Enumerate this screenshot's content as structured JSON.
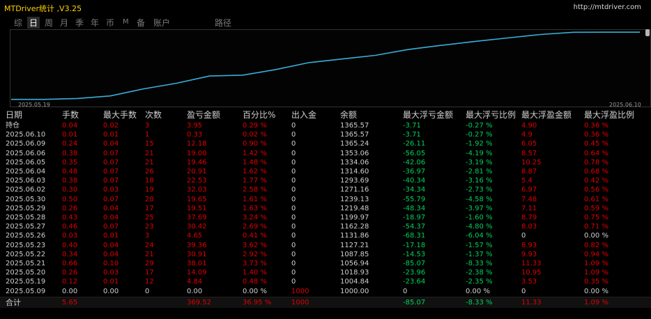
{
  "app": {
    "title": "MTDriver统计 ,V3.25",
    "url": "http://mtdriver.com"
  },
  "colors": {
    "accent_title": "#ffd200",
    "equity_line": "#3aaed8",
    "loss_red": "#e00000",
    "gain_green": "#00d25a"
  },
  "tabs": [
    {
      "label": "综",
      "active": false
    },
    {
      "label": "日",
      "active": true
    },
    {
      "label": "周",
      "active": false
    },
    {
      "label": "月",
      "active": false
    },
    {
      "label": "季",
      "active": false
    },
    {
      "label": "年",
      "active": false
    },
    {
      "label": "币",
      "active": false
    },
    {
      "label": "M",
      "active": false
    },
    {
      "label": "备",
      "active": false
    },
    {
      "label": "账户",
      "active": false
    },
    {
      "label": "路径",
      "active": false
    }
  ],
  "chart_data": {
    "type": "line",
    "x_start": "2025.05.19",
    "x_end": "2025.06.10",
    "series": [
      {
        "values": [
          1000,
          1000,
          1004.84,
          1018.93,
          1056.94,
          1087.85,
          1127.21,
          1131.86,
          1162.28,
          1199.97,
          1219.48,
          1239.13,
          1271.16,
          1293.69,
          1314.6,
          1334.06,
          1353.06,
          1365.24,
          1365.57,
          1365.57
        ]
      }
    ]
  },
  "table": {
    "columns": [
      "日期",
      "手数",
      "最大手数",
      "次数",
      "盈亏金额",
      "百分比%",
      "出入金",
      "余额",
      "最大浮亏金额",
      "最大浮亏比例",
      "最大浮盈金额",
      "最大浮盈比例"
    ],
    "rows": [
      [
        "持仓",
        "0.04",
        "0.02",
        "3",
        "3.95",
        "0.29 %",
        "0",
        "1365.57",
        "-3.71",
        "-0.27 %",
        "4.90",
        "0.36 %"
      ],
      [
        "2025.06.10",
        "0.01",
        "0.01",
        "1",
        "0.33",
        "0.02 %",
        "0",
        "1365.57",
        "-3.71",
        "-0.27 %",
        "4.9",
        "0.36 %"
      ],
      [
        "2025.06.09",
        "0.24",
        "0.04",
        "15",
        "12.18",
        "0.90 %",
        "0",
        "1365.24",
        "-26.11",
        "-1.92 %",
        "6.05",
        "0.45 %"
      ],
      [
        "2025.06.06",
        "0.38",
        "0.07",
        "21",
        "19.00",
        "1.42 %",
        "0",
        "1353.06",
        "-56.05",
        "-4.19 %",
        "8.57",
        "0.64 %"
      ],
      [
        "2025.06.05",
        "0.35",
        "0.07",
        "21",
        "19.46",
        "1.48 %",
        "0",
        "1334.06",
        "-42.06",
        "-3.19 %",
        "10.25",
        "0.78 %"
      ],
      [
        "2025.06.04",
        "0.48",
        "0.07",
        "26",
        "20.91",
        "1.62 %",
        "0",
        "1314.60",
        "-36.97",
        "-2.81 %",
        "8.87",
        "0.68 %"
      ],
      [
        "2025.06.03",
        "0.38",
        "0.07",
        "18",
        "22.53",
        "1.77 %",
        "0",
        "1293.69",
        "-40.34",
        "-3.16 %",
        "5.4",
        "0.42 %"
      ],
      [
        "2025.06.02",
        "0.30",
        "0.03",
        "19",
        "32.03",
        "2.58 %",
        "0",
        "1271.16",
        "-34.34",
        "-2.73 %",
        "6.97",
        "0.56 %"
      ],
      [
        "2025.05.30",
        "0.50",
        "0.07",
        "28",
        "19.65",
        "1.61 %",
        "0",
        "1239.13",
        "-55.79",
        "-4.58 %",
        "7.48",
        "0.61 %"
      ],
      [
        "2025.05.29",
        "0.26",
        "0.04",
        "17",
        "19.51",
        "1.63 %",
        "0",
        "1219.48",
        "-48.34",
        "-3.97 %",
        "7.11",
        "0.59 %"
      ],
      [
        "2025.05.28",
        "0.43",
        "0.04",
        "25",
        "37.69",
        "3.24 %",
        "0",
        "1199.97",
        "-18.97",
        "-1.60 %",
        "8.79",
        "0.75 %"
      ],
      [
        "2025.05.27",
        "0.46",
        "0.07",
        "23",
        "30.42",
        "2.69 %",
        "0",
        "1162.28",
        "-54.37",
        "-4.80 %",
        "8.03",
        "0.71 %"
      ],
      [
        "2025.05.26",
        "0.03",
        "0.01",
        "3",
        "4.65",
        "0.41 %",
        "0",
        "1131.86",
        "-68.31",
        "-6.04 %",
        "0",
        "0.00 %"
      ],
      [
        "2025.05.23",
        "0.40",
        "0.04",
        "24",
        "39.36",
        "3.62 %",
        "0",
        "1127.21",
        "-17.18",
        "-1.57 %",
        "8.93",
        "0.82 %"
      ],
      [
        "2025.05.22",
        "0.34",
        "0.04",
        "21",
        "30.91",
        "2.92 %",
        "0",
        "1087.85",
        "-14.53",
        "-1.37 %",
        "9.93",
        "0.94 %"
      ],
      [
        "2025.05.21",
        "0.66",
        "0.10",
        "29",
        "38.01",
        "3.73 %",
        "0",
        "1056.94",
        "-85.07",
        "-8.33 %",
        "11.33",
        "1.09 %"
      ],
      [
        "2025.05.20",
        "0.26",
        "0.03",
        "17",
        "14.09",
        "1.40 %",
        "0",
        "1018.93",
        "-23.96",
        "-2.38 %",
        "10.95",
        "1.09 %"
      ],
      [
        "2025.05.19",
        "0.12",
        "0.01",
        "12",
        "4.84",
        "0.48 %",
        "0",
        "1004.84",
        "-23.64",
        "-2.35 %",
        "3.53",
        "0.35 %"
      ],
      [
        "2025.05.09",
        "0.00",
        "0.00",
        "0",
        "0.00",
        "0.00 %",
        "1000",
        "1000.00",
        "0",
        "0.00 %",
        "0",
        "0.00 %"
      ]
    ],
    "total": [
      "合计",
      "5.65",
      "",
      "",
      "369.52",
      "36.95 %",
      "1000",
      "",
      "-85.07",
      "-8.33 %",
      "11.33",
      "1.09 %"
    ]
  }
}
